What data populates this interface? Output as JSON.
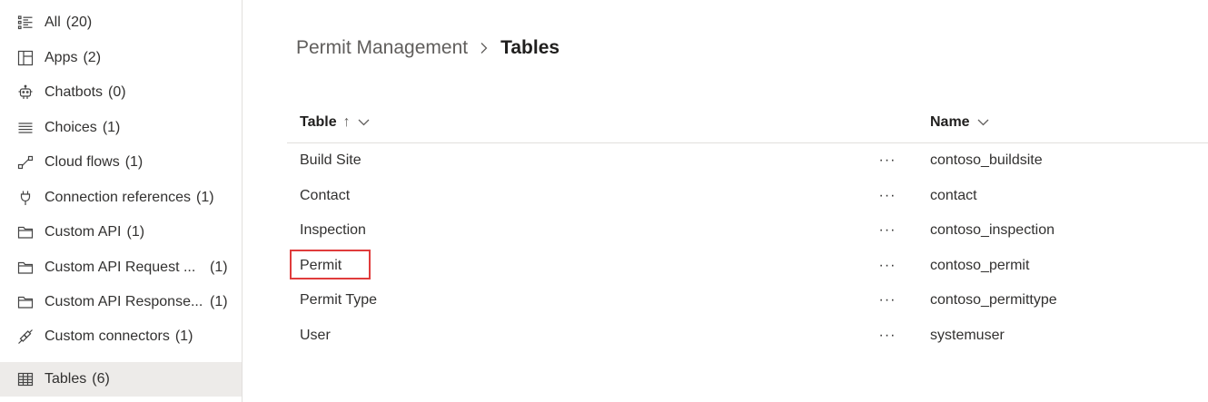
{
  "sidebar": {
    "items": [
      {
        "label": "All",
        "count": "(20)",
        "icon": "list-icon"
      },
      {
        "label": "Apps",
        "count": "(2)",
        "icon": "apps-icon"
      },
      {
        "label": "Chatbots",
        "count": "(0)",
        "icon": "chatbot-icon"
      },
      {
        "label": "Choices",
        "count": "(1)",
        "icon": "choices-icon"
      },
      {
        "label": "Cloud flows",
        "count": "(1)",
        "icon": "flow-icon"
      },
      {
        "label": "Connection references",
        "count": "(1)",
        "icon": "plug-icon"
      },
      {
        "label": "Custom API",
        "count": "(1)",
        "icon": "folder-icon"
      },
      {
        "label": "Custom API Request ...",
        "count": "(1)",
        "icon": "folder-icon"
      },
      {
        "label": "Custom API Response...",
        "count": "(1)",
        "icon": "folder-icon"
      },
      {
        "label": "Custom connectors",
        "count": "(1)",
        "icon": "connector-icon"
      },
      {
        "label": "Tables",
        "count": "(6)",
        "icon": "table-icon",
        "selected": true
      }
    ]
  },
  "breadcrumb": {
    "parent": "Permit Management",
    "current": "Tables"
  },
  "table": {
    "columns": {
      "table": "Table",
      "table_sort": "↑",
      "name": "Name"
    },
    "more_label": "···",
    "rows": [
      {
        "table": "Build Site",
        "name": "contoso_buildsite"
      },
      {
        "table": "Contact",
        "name": "contact"
      },
      {
        "table": "Inspection",
        "name": "contoso_inspection"
      },
      {
        "table": "Permit",
        "name": "contoso_permit",
        "highlighted": true
      },
      {
        "table": "Permit Type",
        "name": "contoso_permittype"
      },
      {
        "table": "User",
        "name": "systemuser"
      }
    ]
  },
  "colors": {
    "highlight": "#e03c3c",
    "selected_bg": "#edebe9"
  }
}
